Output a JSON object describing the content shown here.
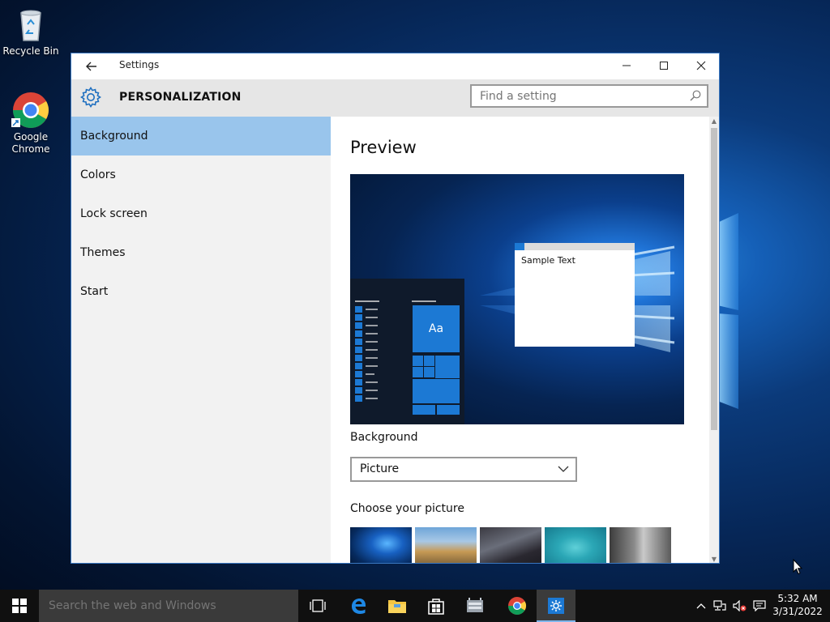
{
  "desktop": {
    "icons": [
      {
        "label": "Recycle Bin"
      },
      {
        "label_line1": "Google",
        "label_line2": "Chrome"
      }
    ]
  },
  "window": {
    "title": "Settings",
    "header_title": "PERSONALIZATION",
    "search": {
      "placeholder": "Find a setting",
      "value": ""
    }
  },
  "nav": {
    "items": [
      {
        "label": "Background",
        "selected": true
      },
      {
        "label": "Colors",
        "selected": false
      },
      {
        "label": "Lock screen",
        "selected": false
      },
      {
        "label": "Themes",
        "selected": false
      },
      {
        "label": "Start",
        "selected": false
      }
    ]
  },
  "content": {
    "preview_title": "Preview",
    "preview_sample_text": "Sample Text",
    "preview_tile_text": "Aa",
    "background_label": "Background",
    "background_value": "Picture",
    "choose_label": "Choose your picture"
  },
  "taskbar": {
    "search_placeholder": "Search the web and Windows",
    "apps": [
      "task-view",
      "edge",
      "file-explorer",
      "store",
      "settings-app-gray",
      "chrome",
      "settings"
    ],
    "active_app": "settings",
    "time": "5:32 AM",
    "date": "3/31/2022"
  },
  "colors": {
    "accent": "#0078d7",
    "nav_selected": "#99c5ec",
    "taskbar": "#101010"
  }
}
